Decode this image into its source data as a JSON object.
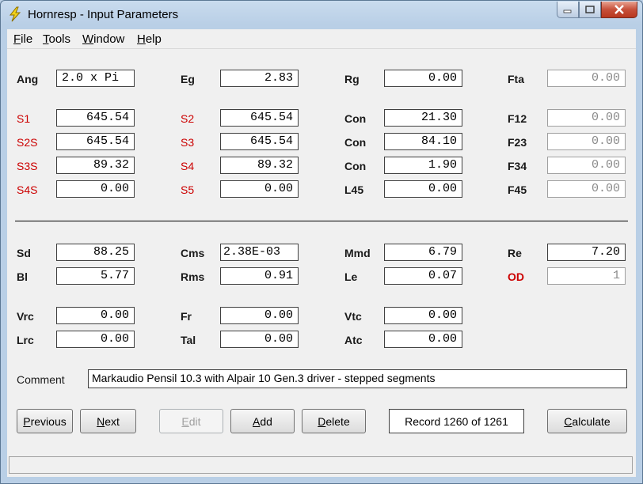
{
  "window": {
    "title": "Hornresp - Input Parameters"
  },
  "menu": {
    "items": [
      {
        "underline": "F",
        "rest": "ile"
      },
      {
        "underline": "T",
        "rest": "ools"
      },
      {
        "underline": "W",
        "rest": "indow"
      },
      {
        "underline": "H",
        "rest": "elp"
      }
    ]
  },
  "params": {
    "ang": {
      "label": "Ang",
      "value": "2.0 x Pi"
    },
    "eg": {
      "label": "Eg",
      "value": "2.83"
    },
    "rg": {
      "label": "Rg",
      "value": "0.00"
    },
    "fta": {
      "label": "Fta",
      "value": "0.00"
    },
    "s1": {
      "label": "S1",
      "value": "645.54"
    },
    "s2": {
      "label": "S2",
      "value": "645.54"
    },
    "con1": {
      "label": "Con",
      "value": "21.30"
    },
    "f12": {
      "label": "F12",
      "value": "0.00"
    },
    "s2s": {
      "label": "S2S",
      "value": "645.54"
    },
    "s3": {
      "label": "S3",
      "value": "645.54"
    },
    "con2": {
      "label": "Con",
      "value": "84.10"
    },
    "f23": {
      "label": "F23",
      "value": "0.00"
    },
    "s3s": {
      "label": "S3S",
      "value": "89.32"
    },
    "s4": {
      "label": "S4",
      "value": "89.32"
    },
    "con3": {
      "label": "Con",
      "value": "1.90"
    },
    "f34": {
      "label": "F34",
      "value": "0.00"
    },
    "s4s": {
      "label": "S4S",
      "value": "0.00"
    },
    "s5": {
      "label": "S5",
      "value": "0.00"
    },
    "l45": {
      "label": "L45",
      "value": "0.00"
    },
    "f45": {
      "label": "F45",
      "value": "0.00"
    },
    "sd": {
      "label": "Sd",
      "value": "88.25"
    },
    "cms": {
      "label": "Cms",
      "value": "2.38E-03"
    },
    "mmd": {
      "label": "Mmd",
      "value": "6.79"
    },
    "re": {
      "label": "Re",
      "value": "7.20"
    },
    "bl": {
      "label": "Bl",
      "value": "5.77"
    },
    "rms": {
      "label": "Rms",
      "value": "0.91"
    },
    "le": {
      "label": "Le",
      "value": "0.07"
    },
    "od": {
      "label": "OD",
      "value": "1"
    },
    "vrc": {
      "label": "Vrc",
      "value": "0.00"
    },
    "fr": {
      "label": "Fr",
      "value": "0.00"
    },
    "vtc": {
      "label": "Vtc",
      "value": "0.00"
    },
    "lrc": {
      "label": "Lrc",
      "value": "0.00"
    },
    "tal": {
      "label": "Tal",
      "value": "0.00"
    },
    "atc": {
      "label": "Atc",
      "value": "0.00"
    }
  },
  "comment": {
    "label": "Comment",
    "value": "Markaudio Pensil 10.3 with Alpair 10 Gen.3 driver - stepped segments"
  },
  "buttons": {
    "previous": {
      "underline": "P",
      "rest": "revious"
    },
    "next": {
      "underline": "N",
      "rest": "ext"
    },
    "edit": {
      "underline": "E",
      "rest": "dit"
    },
    "add": {
      "underline": "A",
      "rest": "dd"
    },
    "delete": {
      "underline": "D",
      "rest": "elete"
    },
    "calculate": {
      "underline": "C",
      "rest": "alculate"
    }
  },
  "record": {
    "text": "Record 1260 of 1261"
  },
  "colors": {
    "param_red": "#cc0000",
    "title_bar": "#b9cfe6",
    "close_button": "#c7503a"
  }
}
